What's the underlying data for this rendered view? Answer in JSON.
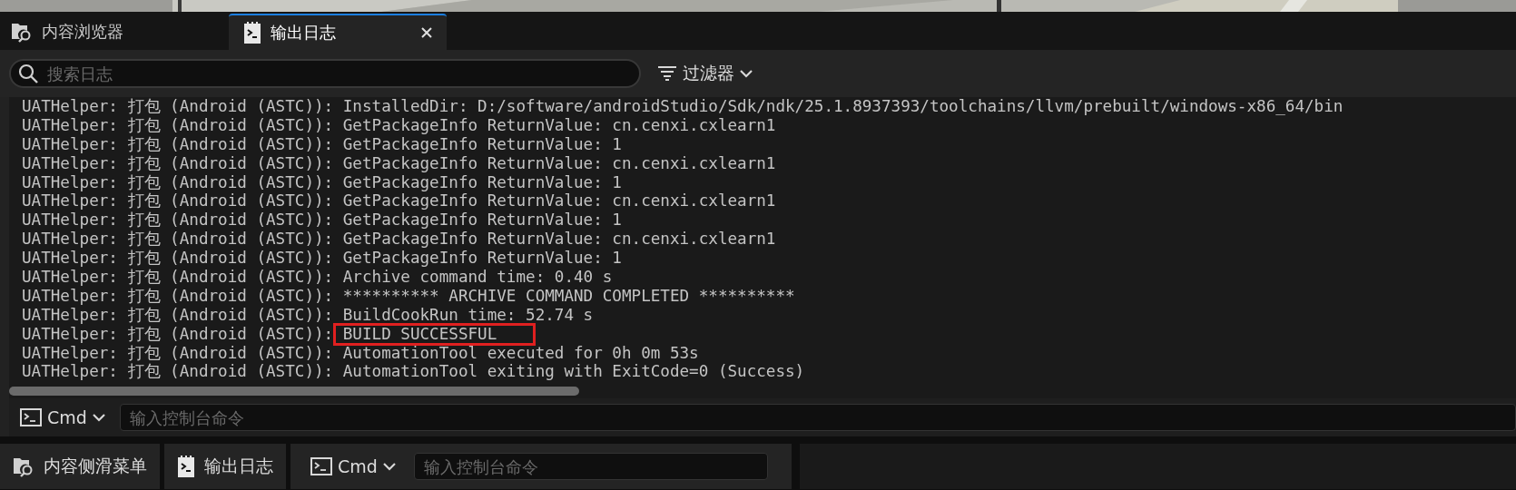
{
  "panel_tabs": [
    {
      "label": "内容浏览器",
      "kind": "folder",
      "selected": false,
      "closable": false
    },
    {
      "label": "输出日志",
      "kind": "log",
      "selected": true,
      "closable": true
    }
  ],
  "search": {
    "placeholder": "搜索日志"
  },
  "filter_button": {
    "label": "过滤器"
  },
  "log_lines": [
    {
      "source": "UATHelper: 打包 (Android (ASTC)):",
      "message": "InstalledDir: D:/software/androidStudio/Sdk/ndk/25.1.8937393/toolchains/llvm/prebuilt/windows-x86_64/bin",
      "highlighted": false
    },
    {
      "source": "UATHelper: 打包 (Android (ASTC)):",
      "message": "GetPackageInfo ReturnValue: cn.cenxi.cxlearn1",
      "highlighted": false
    },
    {
      "source": "UATHelper: 打包 (Android (ASTC)):",
      "message": "GetPackageInfo ReturnValue: 1",
      "highlighted": false
    },
    {
      "source": "UATHelper: 打包 (Android (ASTC)):",
      "message": "GetPackageInfo ReturnValue: cn.cenxi.cxlearn1",
      "highlighted": false
    },
    {
      "source": "UATHelper: 打包 (Android (ASTC)):",
      "message": "GetPackageInfo ReturnValue: 1",
      "highlighted": false
    },
    {
      "source": "UATHelper: 打包 (Android (ASTC)):",
      "message": "GetPackageInfo ReturnValue: cn.cenxi.cxlearn1",
      "highlighted": false
    },
    {
      "source": "UATHelper: 打包 (Android (ASTC)):",
      "message": "GetPackageInfo ReturnValue: 1",
      "highlighted": false
    },
    {
      "source": "UATHelper: 打包 (Android (ASTC)):",
      "message": "GetPackageInfo ReturnValue: cn.cenxi.cxlearn1",
      "highlighted": false
    },
    {
      "source": "UATHelper: 打包 (Android (ASTC)):",
      "message": "GetPackageInfo ReturnValue: 1",
      "highlighted": false
    },
    {
      "source": "UATHelper: 打包 (Android (ASTC)):",
      "message": "Archive command time: 0.40 s",
      "highlighted": false
    },
    {
      "source": "UATHelper: 打包 (Android (ASTC)):",
      "message": "********** ARCHIVE COMMAND COMPLETED **********",
      "highlighted": false
    },
    {
      "source": "UATHelper: 打包 (Android (ASTC)):",
      "message": "BuildCookRun time: 52.74 s",
      "highlighted": false
    },
    {
      "source": "UATHelper: 打包 (Android (ASTC)):",
      "message": "BUILD SUCCESSFUL",
      "highlighted": true
    },
    {
      "source": "UATHelper: 打包 (Android (ASTC)):",
      "message": "AutomationTool executed for 0h 0m 53s",
      "highlighted": false
    },
    {
      "source": "UATHelper: 打包 (Android (ASTC)):",
      "message": "AutomationTool exiting with ExitCode=0 (Success)",
      "highlighted": false
    }
  ],
  "console": {
    "button": "Cmd",
    "placeholder": "输入控制台命令"
  },
  "bottom_bar": {
    "items": [
      {
        "label": "内容侧滑菜单",
        "kind": "folder"
      },
      {
        "label": "输出日志",
        "kind": "log"
      }
    ],
    "console": {
      "button": "Cmd",
      "placeholder": "输入控制台命令"
    }
  }
}
